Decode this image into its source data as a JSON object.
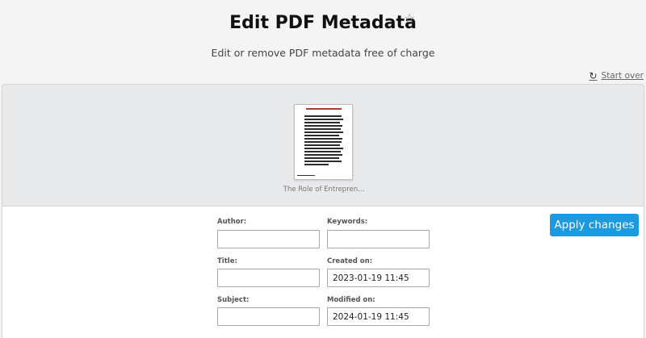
{
  "header": {
    "title": "Edit PDF Metadata",
    "subtitle": "Edit or remove PDF metadata free of charge",
    "start_over_label": "Start over"
  },
  "preview": {
    "filename": "The Role of Entrepren..."
  },
  "form": {
    "author_label": "Author:",
    "author_value": "",
    "keywords_label": "Keywords:",
    "keywords_value": "",
    "title_label": "Title:",
    "title_value": "",
    "created_label": "Created on:",
    "created_value": "2023-01-19 11:45",
    "subject_label": "Subject:",
    "subject_value": "",
    "modified_label": "Modified on:",
    "modified_value": "2024-01-19 11:45",
    "apply_label": "Apply changes"
  },
  "icons": {
    "favorite": "star-icon",
    "reload": "reload-icon"
  },
  "colors": {
    "accent": "#1b9ae0",
    "background": "#f4f4f4",
    "preview_bg": "#e8e9eb"
  }
}
